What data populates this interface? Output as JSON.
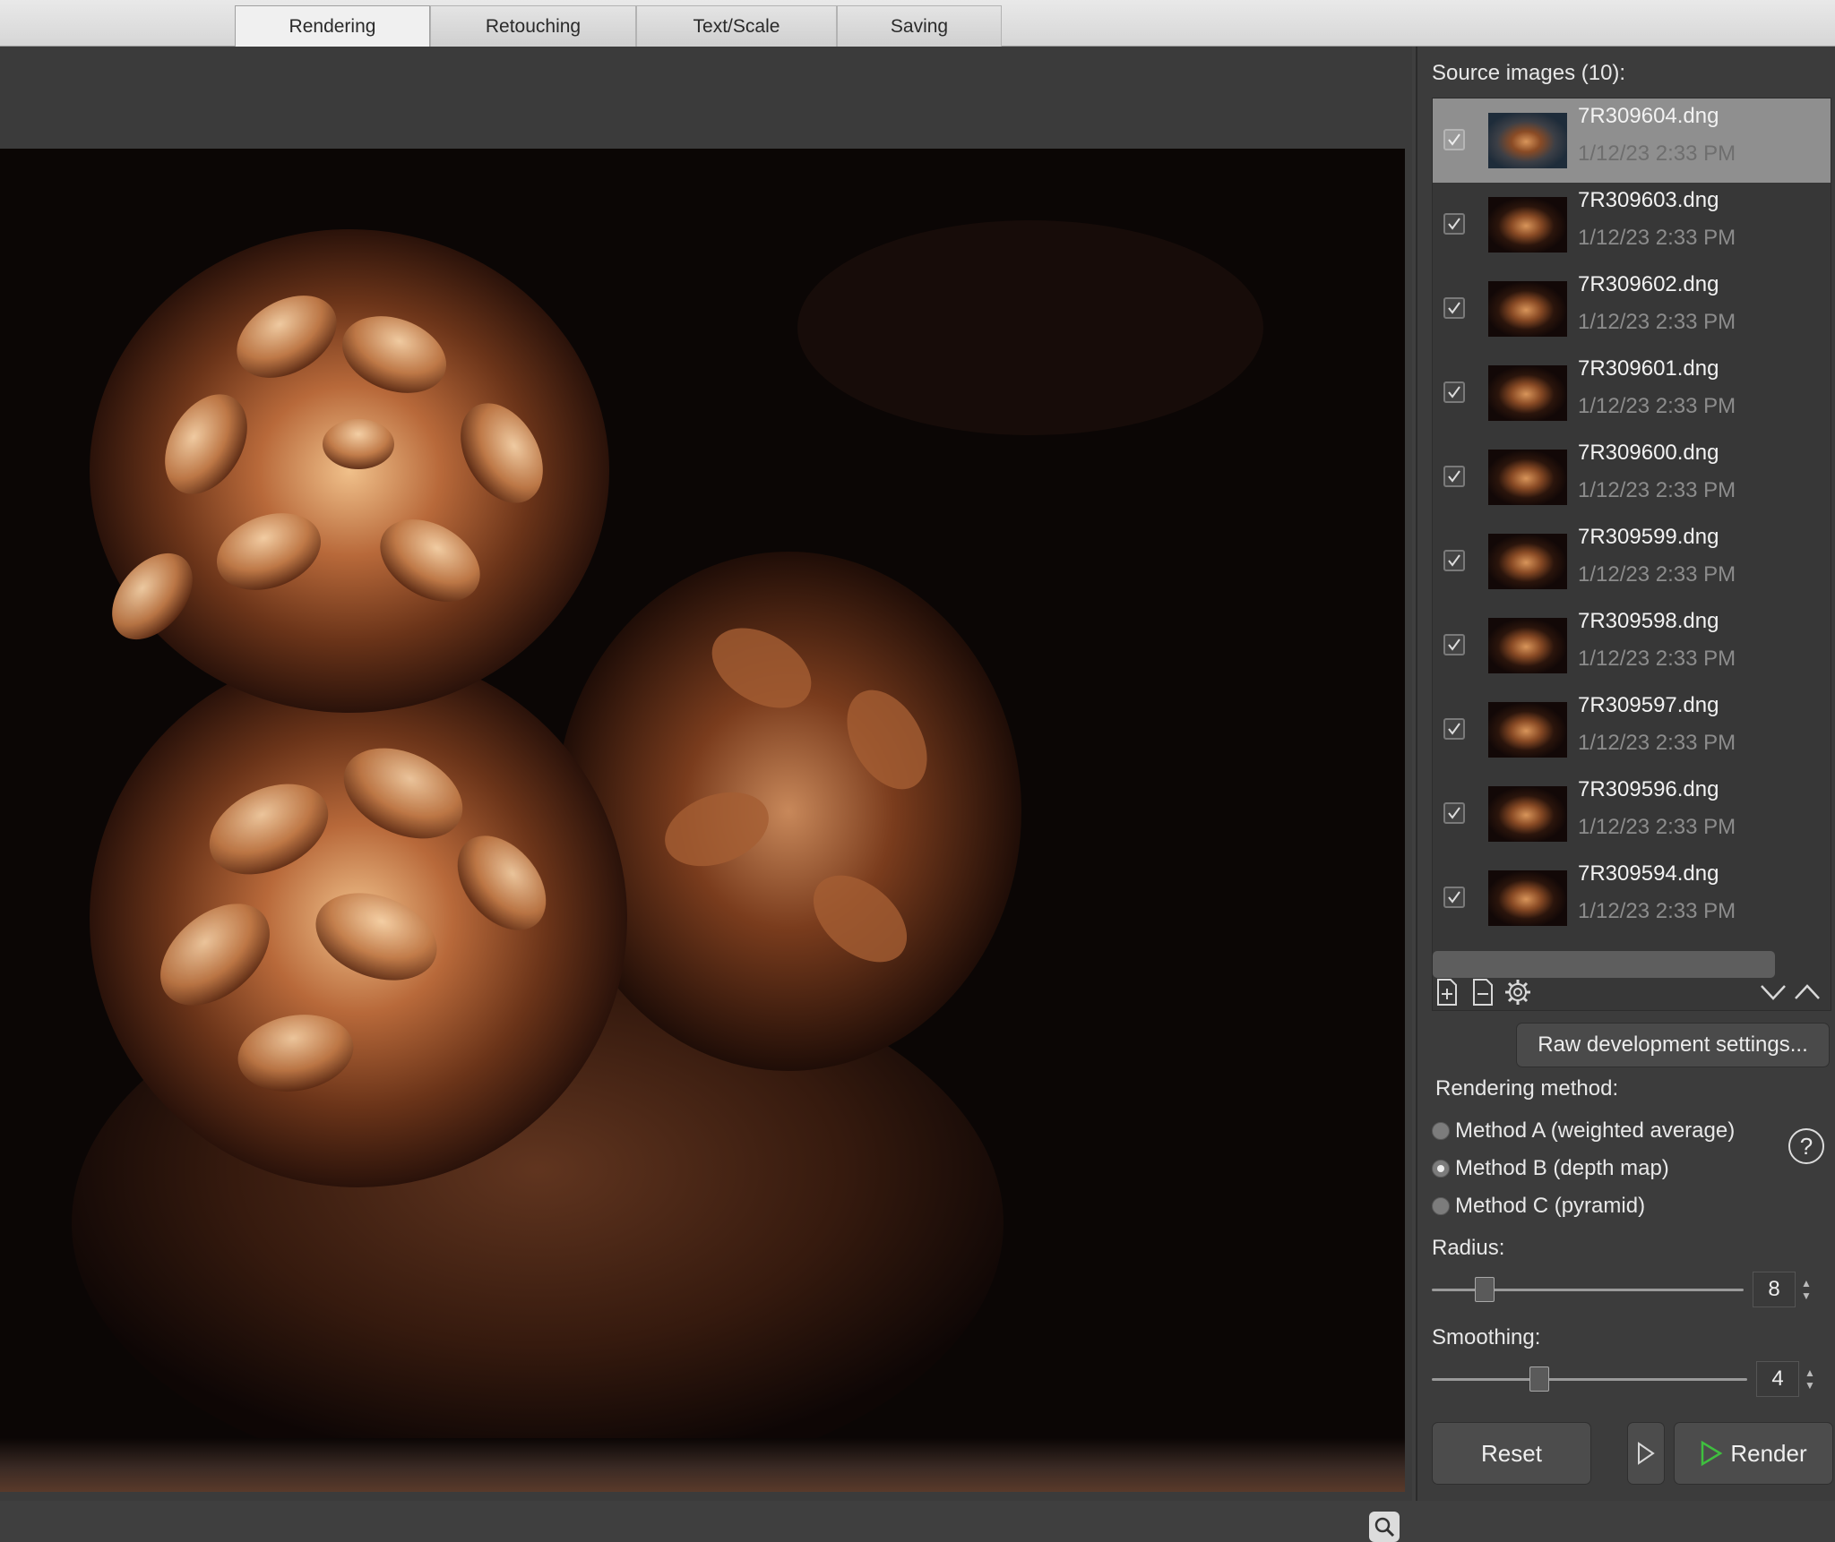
{
  "tabs": [
    {
      "label": "Rendering",
      "active": true
    },
    {
      "label": "Retouching"
    },
    {
      "label": "Text/Scale"
    },
    {
      "label": "Saving"
    }
  ],
  "source": {
    "header": "Source images (10):",
    "files": [
      {
        "name": "7R309604.dng",
        "date": "1/12/23 2:33 PM",
        "checked": true,
        "selected": true
      },
      {
        "name": "7R309603.dng",
        "date": "1/12/23 2:33 PM",
        "checked": true
      },
      {
        "name": "7R309602.dng",
        "date": "1/12/23 2:33 PM",
        "checked": true
      },
      {
        "name": "7R309601.dng",
        "date": "1/12/23 2:33 PM",
        "checked": true
      },
      {
        "name": "7R309600.dng",
        "date": "1/12/23 2:33 PM",
        "checked": true
      },
      {
        "name": "7R309599.dng",
        "date": "1/12/23 2:33 PM",
        "checked": true
      },
      {
        "name": "7R309598.dng",
        "date": "1/12/23 2:33 PM",
        "checked": true
      },
      {
        "name": "7R309597.dng",
        "date": "1/12/23 2:33 PM",
        "checked": true
      },
      {
        "name": "7R309596.dng",
        "date": "1/12/23 2:33 PM",
        "checked": true
      },
      {
        "name": "7R309594.dng",
        "date": "1/12/23 2:33 PM",
        "checked": true
      }
    ]
  },
  "toolbar_icons": [
    "add-file-icon",
    "remove-file-icon",
    "settings-gear-icon",
    "chevron-down-icon",
    "chevron-up-icon"
  ],
  "raw_button": "Raw development settings...",
  "rendering": {
    "label": "Rendering method:",
    "methods": [
      {
        "label": "Method A (weighted average)",
        "selected": false
      },
      {
        "label": "Method B (depth map)",
        "selected": true
      },
      {
        "label": "Method C (pyramid)",
        "selected": false
      }
    ],
    "help": "?"
  },
  "radius": {
    "label": "Radius:",
    "value": "8",
    "position": 0.17
  },
  "smoothing": {
    "label": "Smoothing:",
    "value": "4",
    "position": 0.34
  },
  "buttons": {
    "reset": "Reset",
    "render": "Render"
  },
  "colors": {
    "render_accent": "#3fbf3f",
    "selection": "#8f8f8f",
    "panel": "#3c3c3c"
  }
}
